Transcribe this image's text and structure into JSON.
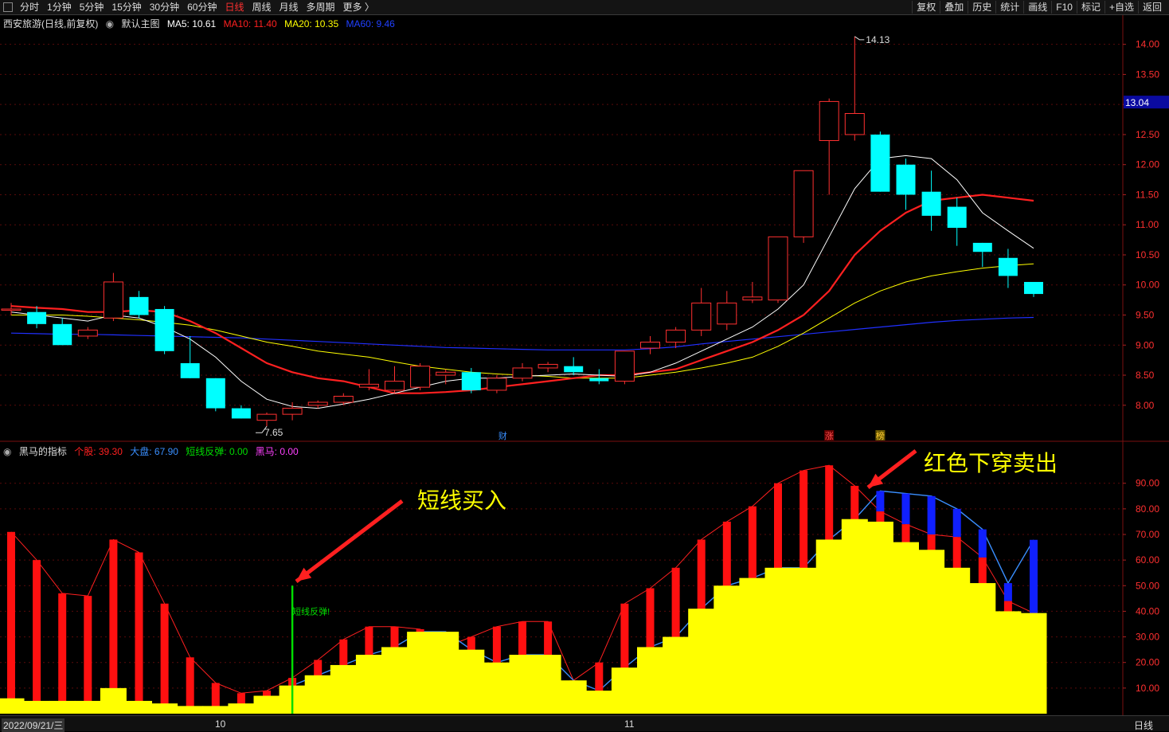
{
  "toolbar": {
    "timeframes": [
      "分时",
      "1分钟",
      "5分钟",
      "15分钟",
      "30分钟",
      "60分钟",
      "日线",
      "周线",
      "月线",
      "多周期",
      "更多 〉"
    ],
    "active_timeframe": "日线",
    "right_buttons": [
      "复权",
      "叠加",
      "历史",
      "统计",
      "画线",
      "F10",
      "标记",
      "+自选",
      "返回"
    ]
  },
  "main_header": {
    "stock": "西安旅游(日线,前复权)",
    "template": "默认主图",
    "ma": [
      {
        "label": "MA5: 10.61",
        "color": "#ffffff"
      },
      {
        "label": "MA10: 11.40",
        "color": "#ff2020"
      },
      {
        "label": "MA20: 10.35",
        "color": "#ffff00"
      },
      {
        "label": "MA60: 9.46",
        "color": "#2040ff"
      }
    ]
  },
  "sub_header": {
    "name": "黑马的指标",
    "items": [
      {
        "label": "个股: 39.30",
        "color": "#ff2020"
      },
      {
        "label": "大盘: 67.90",
        "color": "#3a8fff"
      },
      {
        "label": "短线反弹: 0.00",
        "color": "#00dd00"
      },
      {
        "label": "黑马: 0.00",
        "color": "#ff40ff"
      }
    ]
  },
  "annotations": {
    "buy": "短线买入",
    "sell": "红色下穿卖出",
    "rebound_label": "短线反弹!"
  },
  "markers": {
    "cai": "财",
    "zhang": "涨",
    "bang": "榜"
  },
  "bottom": {
    "date": "2022/09/21/三",
    "month_10": "10",
    "month_11": "11",
    "period": "日线"
  },
  "colors": {
    "up": "#ff3030",
    "down": "#00ffff",
    "ma5": "#ffffff",
    "ma10": "#ff2020",
    "ma20": "#ffff00",
    "ma60": "#2030ff",
    "individual": "#ff2020",
    "market": "#3a8fff",
    "fill": "#ffff00",
    "rebound": "#00dd00"
  },
  "chart_data": [
    {
      "type": "candlestick",
      "title": "西安旅游(日线,前复权)",
      "ylim": [
        7.6,
        14.3
      ],
      "y_ticks": [
        8.0,
        8.5,
        9.0,
        9.5,
        10.0,
        10.5,
        11.0,
        11.5,
        12.0,
        12.5,
        13.0,
        13.5,
        14.0
      ],
      "current_price": "13.04",
      "high_label": "14.13",
      "low_label": "7.65",
      "candles": [
        {
          "o": 9.6,
          "h": 9.7,
          "l": 9.5,
          "c": 9.6
        },
        {
          "o": 9.55,
          "h": 9.65,
          "l": 9.28,
          "c": 9.35
        },
        {
          "o": 9.35,
          "h": 9.45,
          "l": 9.0,
          "c": 9.0
        },
        {
          "o": 9.15,
          "h": 9.3,
          "l": 9.1,
          "c": 9.25
        },
        {
          "o": 9.45,
          "h": 10.2,
          "l": 9.4,
          "c": 10.05
        },
        {
          "o": 9.8,
          "h": 9.9,
          "l": 9.45,
          "c": 9.5
        },
        {
          "o": 9.6,
          "h": 9.65,
          "l": 8.85,
          "c": 8.9
        },
        {
          "o": 8.7,
          "h": 9.15,
          "l": 8.45,
          "c": 8.45
        },
        {
          "o": 8.45,
          "h": 8.45,
          "l": 7.9,
          "c": 7.95
        },
        {
          "o": 7.95,
          "h": 8.0,
          "l": 7.78,
          "c": 7.78
        },
        {
          "o": 7.75,
          "h": 7.88,
          "l": 7.65,
          "c": 7.85
        },
        {
          "o": 7.85,
          "h": 8.05,
          "l": 7.75,
          "c": 7.95
        },
        {
          "o": 8.0,
          "h": 8.08,
          "l": 7.95,
          "c": 8.05
        },
        {
          "o": 8.05,
          "h": 8.2,
          "l": 8.0,
          "c": 8.15
        },
        {
          "o": 8.3,
          "h": 8.6,
          "l": 8.25,
          "c": 8.35
        },
        {
          "o": 8.25,
          "h": 8.65,
          "l": 8.2,
          "c": 8.4
        },
        {
          "o": 8.3,
          "h": 8.7,
          "l": 8.25,
          "c": 8.65
        },
        {
          "o": 8.5,
          "h": 8.6,
          "l": 8.35,
          "c": 8.55
        },
        {
          "o": 8.55,
          "h": 8.62,
          "l": 8.2,
          "c": 8.25
        },
        {
          "o": 8.25,
          "h": 8.5,
          "l": 8.2,
          "c": 8.45
        },
        {
          "o": 8.45,
          "h": 8.7,
          "l": 8.4,
          "c": 8.62
        },
        {
          "o": 8.62,
          "h": 8.72,
          "l": 8.55,
          "c": 8.68
        },
        {
          "o": 8.65,
          "h": 8.8,
          "l": 8.5,
          "c": 8.55
        },
        {
          "o": 8.45,
          "h": 8.6,
          "l": 8.35,
          "c": 8.4
        },
        {
          "o": 8.4,
          "h": 8.9,
          "l": 8.35,
          "c": 8.9
        },
        {
          "o": 8.95,
          "h": 9.15,
          "l": 8.85,
          "c": 9.05
        },
        {
          "o": 9.05,
          "h": 9.3,
          "l": 8.95,
          "c": 9.25
        },
        {
          "o": 9.25,
          "h": 9.95,
          "l": 9.15,
          "c": 9.7
        },
        {
          "o": 9.35,
          "h": 9.9,
          "l": 9.25,
          "c": 9.7
        },
        {
          "o": 9.75,
          "h": 10.05,
          "l": 9.7,
          "c": 9.8
        },
        {
          "o": 9.75,
          "h": 10.8,
          "l": 9.7,
          "c": 10.8
        },
        {
          "o": 10.8,
          "h": 11.9,
          "l": 10.7,
          "c": 11.9
        },
        {
          "o": 12.4,
          "h": 13.1,
          "l": 11.5,
          "c": 13.05
        },
        {
          "o": 12.5,
          "h": 14.13,
          "l": 12.4,
          "c": 12.85
        },
        {
          "o": 12.5,
          "h": 12.55,
          "l": 11.55,
          "c": 11.55
        },
        {
          "o": 12.0,
          "h": 12.1,
          "l": 11.25,
          "c": 11.5
        },
        {
          "o": 11.55,
          "h": 11.9,
          "l": 10.9,
          "c": 11.15
        },
        {
          "o": 11.3,
          "h": 11.45,
          "l": 10.65,
          "c": 10.95
        },
        {
          "o": 10.7,
          "h": 10.7,
          "l": 10.3,
          "c": 10.55
        },
        {
          "o": 10.45,
          "h": 10.6,
          "l": 9.95,
          "c": 10.15
        },
        {
          "o": 10.05,
          "h": 10.05,
          "l": 9.8,
          "c": 9.85
        }
      ],
      "ma5": [
        9.55,
        9.5,
        9.45,
        9.4,
        9.5,
        9.45,
        9.3,
        9.1,
        8.8,
        8.4,
        8.1,
        7.98,
        7.95,
        8.02,
        8.1,
        8.2,
        8.3,
        8.4,
        8.45,
        8.45,
        8.48,
        8.5,
        8.52,
        8.5,
        8.48,
        8.55,
        8.7,
        8.9,
        9.1,
        9.3,
        9.6,
        10.0,
        10.8,
        11.6,
        12.1,
        12.15,
        12.1,
        11.75,
        11.2,
        10.9,
        10.61
      ],
      "ma10": [
        9.65,
        9.62,
        9.6,
        9.55,
        9.55,
        9.58,
        9.55,
        9.4,
        9.2,
        8.95,
        8.7,
        8.55,
        8.45,
        8.4,
        8.3,
        8.2,
        8.2,
        8.22,
        8.25,
        8.3,
        8.35,
        8.4,
        8.45,
        8.5,
        8.5,
        8.55,
        8.6,
        8.75,
        8.9,
        9.05,
        9.25,
        9.5,
        9.9,
        10.5,
        10.9,
        11.2,
        11.4,
        11.45,
        11.5,
        11.45,
        11.4
      ],
      "ma20": [
        9.5,
        9.5,
        9.5,
        9.48,
        9.45,
        9.42,
        9.38,
        9.33,
        9.25,
        9.15,
        9.05,
        8.98,
        8.9,
        8.85,
        8.8,
        8.72,
        8.65,
        8.6,
        8.55,
        8.52,
        8.5,
        8.48,
        8.45,
        8.45,
        8.45,
        8.5,
        8.55,
        8.62,
        8.7,
        8.8,
        8.98,
        9.2,
        9.45,
        9.7,
        9.9,
        10.05,
        10.15,
        10.22,
        10.28,
        10.32,
        10.35
      ],
      "ma60": [
        9.2,
        9.19,
        9.18,
        9.18,
        9.17,
        9.16,
        9.15,
        9.14,
        9.13,
        9.12,
        9.1,
        9.08,
        9.06,
        9.04,
        9.02,
        9.0,
        8.98,
        8.96,
        8.95,
        8.94,
        8.93,
        8.92,
        8.92,
        8.92,
        8.92,
        8.94,
        8.97,
        9.02,
        9.06,
        9.1,
        9.14,
        9.18,
        9.22,
        9.26,
        9.3,
        9.34,
        9.38,
        9.41,
        9.43,
        9.45,
        9.46
      ]
    },
    {
      "type": "bar",
      "title": "黑马的指标",
      "ylim": [
        0,
        98
      ],
      "y_ticks": [
        10,
        20,
        30,
        40,
        50,
        60,
        70,
        80,
        90
      ],
      "series": [
        {
          "name": "个股",
          "values": [
            71,
            60,
            47,
            46,
            68,
            63,
            43,
            22,
            12,
            8,
            9,
            14,
            21,
            29,
            34,
            34,
            33,
            26,
            30,
            34,
            36,
            36,
            13,
            20,
            43,
            49,
            57,
            68,
            75,
            81,
            90,
            95,
            97,
            89,
            79,
            74,
            70,
            69,
            61,
            44,
            39.3
          ]
        },
        {
          "name": "大盘",
          "values": [
            6,
            5,
            5,
            5,
            10,
            5,
            4,
            3,
            3,
            4,
            7,
            11,
            15,
            19,
            23,
            26,
            32,
            32,
            25,
            20,
            23,
            23,
            13,
            9,
            18,
            26,
            30,
            41,
            50,
            53,
            57,
            57,
            68,
            76,
            87,
            86,
            85,
            80,
            72,
            51,
            67.9
          ]
        },
        {
          "name": "短线反弹",
          "values": [
            0,
            0,
            0,
            0,
            0,
            0,
            0,
            0,
            0,
            0,
            0,
            50,
            0,
            0,
            0,
            0,
            0,
            0,
            0,
            0,
            0,
            0,
            0,
            0,
            0,
            0,
            0,
            0,
            0,
            0,
            0,
            0,
            0,
            0,
            0,
            0,
            0,
            0,
            0,
            0,
            0
          ]
        },
        {
          "name": "黑马",
          "values": [
            0,
            0,
            0,
            0,
            0,
            0,
            0,
            0,
            0,
            0,
            0,
            0,
            0,
            0,
            0,
            0,
            0,
            0,
            0,
            0,
            0,
            0,
            0,
            0,
            0,
            0,
            0,
            0,
            0,
            0,
            0,
            0,
            0,
            0,
            0,
            0,
            0,
            0,
            0,
            0,
            0
          ]
        }
      ],
      "fill_values": [
        6,
        5,
        5,
        5,
        10,
        5,
        4,
        3,
        3,
        4,
        7,
        11,
        15,
        19,
        23,
        26,
        32,
        32,
        25,
        20,
        23,
        23,
        13,
        9,
        18,
        26,
        30,
        41,
        50,
        53,
        57,
        57,
        68,
        76,
        75,
        67,
        64,
        57,
        51,
        40,
        39.3
      ]
    }
  ]
}
